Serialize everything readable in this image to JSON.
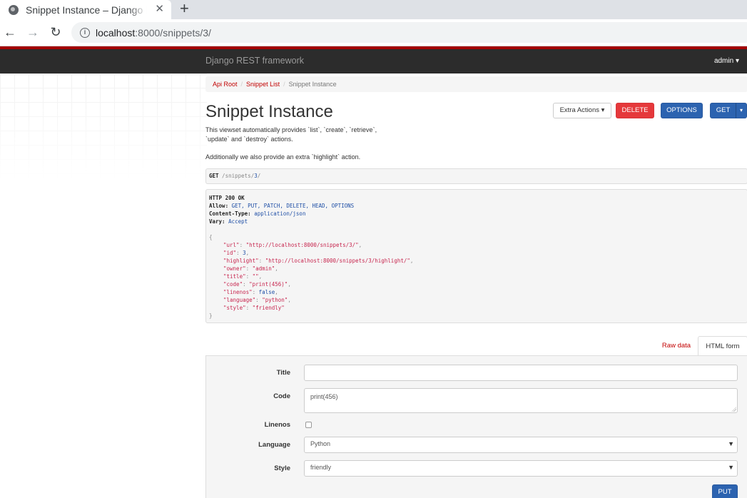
{
  "browser": {
    "tab_title": "Snippet Instance – Django REST framework",
    "tab_close": "✕",
    "new_tab": "+",
    "url_host": "localhost",
    "url_path": ":8000/snippets/3/"
  },
  "navbar": {
    "brand": "Django REST framework",
    "user": "admin"
  },
  "breadcrumb": {
    "items": [
      "Api Root",
      "Snippet List",
      "Snippet Instance"
    ]
  },
  "page": {
    "title": "Snippet Instance",
    "description_line1": "This viewset automatically provides `list`, `create`, `retrieve`,",
    "description_line2": "`update` and `destroy` actions.",
    "description_extra": "Additionally we also provide an extra `highlight` action."
  },
  "actions": {
    "extra_actions": "Extra Actions",
    "delete": "DELETE",
    "options": "OPTIONS",
    "get": "GET"
  },
  "request": {
    "method": "GET",
    "path_prefix": " /snippets/",
    "path_id": "3",
    "path_suffix": "/"
  },
  "response": {
    "status": "HTTP 200 OK",
    "headers": [
      {
        "name": "Allow:",
        "value": "GET, PUT, PATCH, DELETE, HEAD, OPTIONS"
      },
      {
        "name": "Content-Type:",
        "value": "application/json"
      },
      {
        "name": "Vary:",
        "value": "Accept"
      }
    ],
    "json": {
      "url": "\"http://localhost:8000/snippets/3/\"",
      "id": "3",
      "highlight": "\"http://localhost:8000/snippets/3/highlight/\"",
      "owner": "\"admin\"",
      "title": "\"\"",
      "code": "\"print(456)\"",
      "linenos": "false",
      "language": "\"python\"",
      "style": "\"friendly\""
    }
  },
  "form": {
    "tab_raw": "Raw data",
    "tab_html": "HTML form",
    "title_label": "Title",
    "title_value": "",
    "code_label": "Code",
    "code_value": "print(456)",
    "linenos_label": "Linenos",
    "linenos_checked": false,
    "language_label": "Language",
    "language_value": "Python",
    "style_label": "Style",
    "style_value": "friendly",
    "submit": "PUT"
  },
  "colors": {
    "brand_red": "#a30000",
    "link_red": "#c20000",
    "primary_blue": "#2c63b0",
    "danger_red": "#e5383b"
  }
}
